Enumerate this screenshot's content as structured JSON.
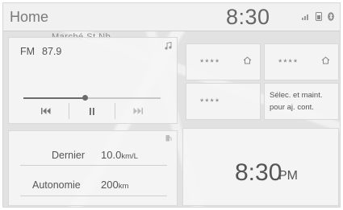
{
  "statusbar": {
    "title": "Home",
    "time": "8:30"
  },
  "map": {
    "street_label": "Marché St.Nb"
  },
  "radio": {
    "band": "FM",
    "frequency": "87.9",
    "progress": 0.45
  },
  "presets": [
    {
      "label": "****"
    },
    {
      "label": "****"
    },
    {
      "label": "****"
    },
    {
      "hint_line1": "Sélec. et maint.",
      "hint_line2": "pour aj. cont."
    }
  ],
  "eco": {
    "rows": [
      {
        "label": "Dernier",
        "value": "10.0",
        "unit": "km/L"
      },
      {
        "label": "Autonomie",
        "value": "200",
        "unit": "km"
      }
    ]
  },
  "clock_widget": {
    "time": "8:30",
    "ampm": "PM"
  },
  "colors": {
    "tile_bg": "#f5f5f5",
    "text": "#555555",
    "statusbar_bg": "#f1f1f1"
  }
}
